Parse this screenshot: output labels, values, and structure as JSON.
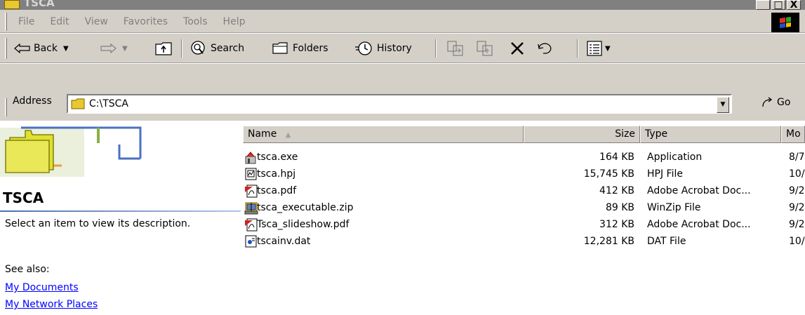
{
  "window": {
    "title": "TSCA",
    "buttons": [
      "_",
      "□",
      "X"
    ]
  },
  "menu": {
    "items": [
      "File",
      "Edit",
      "View",
      "Favorites",
      "Tools",
      "Help"
    ]
  },
  "toolbar": {
    "back_label": "Back",
    "search_label": "Search",
    "folders_label": "Folders",
    "history_label": "History"
  },
  "address": {
    "label": "Address",
    "value": "C:\\TSCA",
    "go_label": "Go"
  },
  "left_pane": {
    "title": "TSCA",
    "description": "Select an item to view its description.",
    "see_also": "See also:",
    "links": [
      "My Documents",
      "My Network Places"
    ]
  },
  "columns": {
    "name": "Name",
    "sort_indicator": "▲",
    "size": "Size",
    "type": "Type",
    "modified": "Mo"
  },
  "files": [
    {
      "name": "tsca.exe",
      "size": "164 KB",
      "type": "Application",
      "modified": "8/7",
      "icon": "application-icon"
    },
    {
      "name": "tsca.hpj",
      "size": "15,745 KB",
      "type": "HPJ File",
      "modified": "10/",
      "icon": "document-icon"
    },
    {
      "name": "tsca.pdf",
      "size": "412 KB",
      "type": "Adobe Acrobat Doc...",
      "modified": "9/2",
      "icon": "pdf-icon"
    },
    {
      "name": "tsca_executable.zip",
      "size": "89 KB",
      "type": "WinZip File",
      "modified": "9/2",
      "icon": "zip-icon"
    },
    {
      "name": "Tsca_slideshow.pdf",
      "size": "312 KB",
      "type": "Adobe Acrobat Doc...",
      "modified": "9/2",
      "icon": "pdf-icon"
    },
    {
      "name": "tscainv.dat",
      "size": "12,281 KB",
      "type": "DAT File",
      "modified": "10/",
      "icon": "dat-file-icon"
    }
  ],
  "colors": {
    "titlebar": "#808080",
    "chrome": "#d4d0c8",
    "link": "#0000ff"
  }
}
